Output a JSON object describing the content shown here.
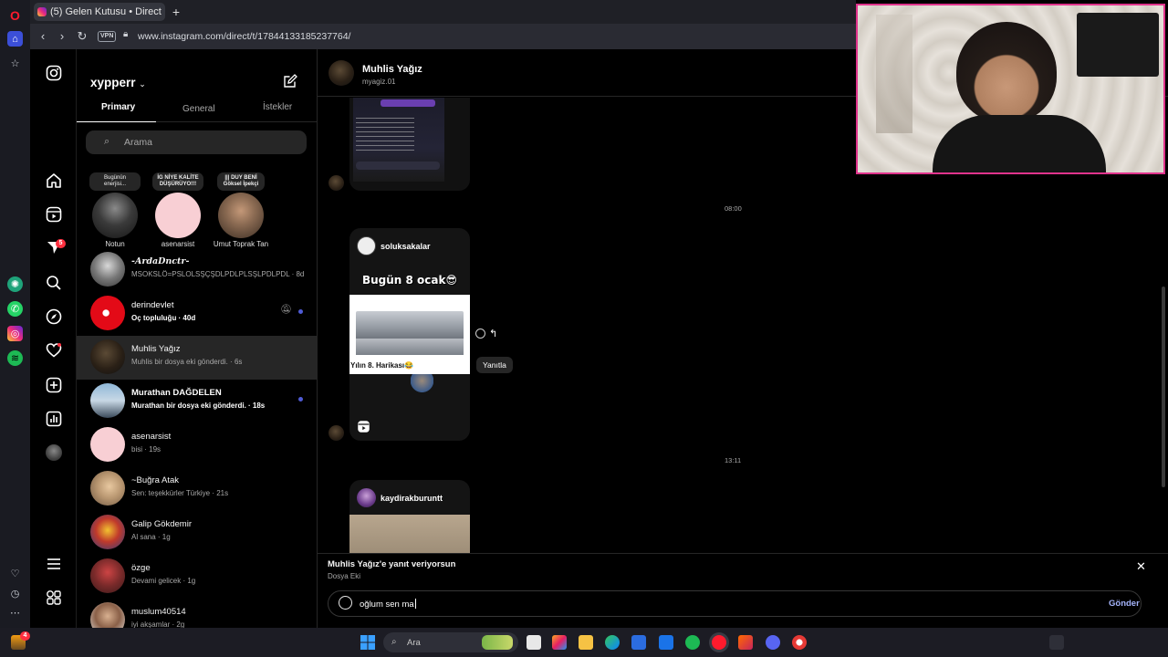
{
  "browser": {
    "tab_title": "(5) Gelen Kutusu • Direct",
    "url": "www.instagram.com/direct/t/17844133185237764/",
    "vpn_label": "VPN"
  },
  "rail": {
    "messages_badge": "5"
  },
  "inbox": {
    "account": "xypperr",
    "tabs": [
      "Primary",
      "General",
      "İstekler"
    ],
    "search_placeholder": "Arama",
    "notes": [
      {
        "bubble": "Bugünün enerjisi...",
        "name": "Notun"
      },
      {
        "bubble": "İG NİYE KALİTE DÜŞÜRÜYO!!!",
        "name": "asenarsist"
      },
      {
        "bubble": "||| DUY BENİ Göksel İpekçi",
        "name": "Umut Toprak Tan"
      }
    ],
    "conversations": [
      {
        "name": "-ArdaDnctr-",
        "preview": "MSOKSLÖ=PSLOLSŞÇŞDLPDLPLSŞLPDLPDL · 8d"
      },
      {
        "name": "derindevlet",
        "preview": "Oç topluluğu · 40d"
      },
      {
        "name": "Muhlis Yağız",
        "preview": "Muhlis bir dosya eki gönderdi. · 6s"
      },
      {
        "name": "Murathan DAĞDELEN",
        "preview": "Murathan bir dosya eki gönderdi. · 18s"
      },
      {
        "name": "asenarsist",
        "preview": "bisi · 19s"
      },
      {
        "name": "~Buğra Atak",
        "preview": "Sen: teşekkürler Türkiye · 21s"
      },
      {
        "name": "Galip Gökdemir",
        "preview": "Al sana · 1g"
      },
      {
        "name": "özge",
        "preview": "Devami gelicek · 1g"
      },
      {
        "name": "muslum40514",
        "preview": "iyi akşamlar · 2g"
      }
    ]
  },
  "chat": {
    "name": "Muhlis Yağız",
    "username": "myagiz.01",
    "times": [
      "08:00",
      "13:11"
    ],
    "post1": {
      "user": "soluksakalar",
      "headline": "Bugün 8 ocak😎",
      "caption": "Yılın 8. Harikası😂"
    },
    "reply_tooltip": "Yanıtla",
    "post2": {
      "user": "kaydirakburuntt"
    },
    "replying_to_title": "Muhlis Yağız'e yanıt veriyorsun",
    "replying_to_sub": "Dosya Eki",
    "composer_text": "oğlum sen ma",
    "send_label": "Gönder"
  },
  "taskbar": {
    "search_placeholder": "Ara"
  }
}
